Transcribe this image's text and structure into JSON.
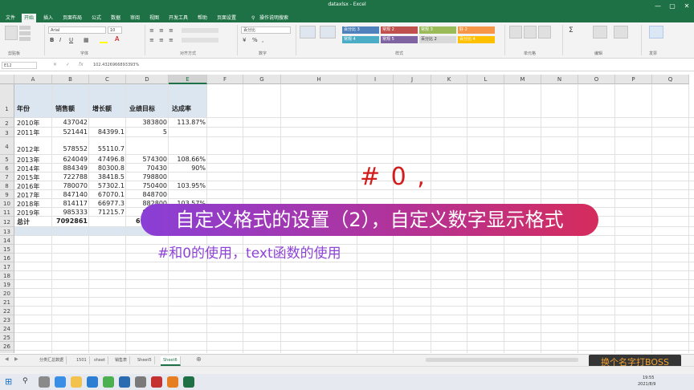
{
  "window": {
    "title": "dataxlsx - Excel",
    "controls": [
      "—",
      "▢",
      "✕"
    ]
  },
  "ribbon": {
    "tabs": [
      "文件",
      "开始",
      "插入",
      "页面布局",
      "公式",
      "数据",
      "审阅",
      "视图",
      "开发工具",
      "帮助",
      "页面设置"
    ],
    "active_tab": "开始",
    "search": "操作说明搜索",
    "font_name": "Arial",
    "font_size": "10",
    "number_format": "百分比",
    "groups": [
      "剪贴板",
      "字体",
      "对齐方式",
      "数字",
      "样式",
      "单元格",
      "编辑",
      "发票"
    ],
    "styles": [
      "百分比 3",
      "常规 2",
      "常规 3",
      "好 2",
      "常规 4",
      "常规 5",
      "百分比 2",
      "百分比 4"
    ],
    "style_colors": [
      "#4f81bd",
      "#c0504d",
      "#9bbb59",
      "#f79646",
      "#4bacc6",
      "#8064a2",
      "#d9d9d9",
      "#ffc000"
    ]
  },
  "formula_bar": {
    "name_box": "E12",
    "formula": "102.4326966893393%"
  },
  "columns": [
    "A",
    "B",
    "C",
    "D",
    "E",
    "F",
    "G",
    "H",
    "I",
    "J",
    "K",
    "L",
    "M",
    "N",
    "O",
    "P",
    "Q"
  ],
  "selected_column": "E",
  "header_row": [
    "年份",
    "销售额",
    "增长额",
    "业绩目标",
    "达成率"
  ],
  "rows": [
    {
      "n": "2",
      "a": "2010年",
      "b": "437042",
      "c": "",
      "d": "383800",
      "e": "113.87%"
    },
    {
      "n": "3",
      "a": "2011年",
      "b": "521441",
      "c": "84399.1",
      "d": "5",
      "e": ""
    },
    {
      "n": "4",
      "a": "2012年",
      "b": "578552",
      "c": "55110.7",
      "d": "",
      "e": ""
    },
    {
      "n": "5",
      "a": "2013年",
      "b": "624049",
      "c": "47496.8",
      "d": "574300",
      "e": "108.66%"
    },
    {
      "n": "6",
      "a": "2014年",
      "b": "884349",
      "c": "80300.8",
      "d": "70430",
      "e": "90%"
    },
    {
      "n": "7",
      "a": "2015年",
      "b": "722788",
      "c": "38418.5",
      "d": "798800",
      "e": ""
    },
    {
      "n": "8",
      "a": "2016年",
      "b": "780070",
      "c": "57302.1",
      "d": "750400",
      "e": "103.95%"
    },
    {
      "n": "9",
      "a": "2017年",
      "b": "847140",
      "c": "67070.1",
      "d": "848700",
      "e": ""
    },
    {
      "n": "10",
      "a": "2018年",
      "b": "814117",
      "c": "66977.3",
      "d": "882800",
      "e": "103.57%"
    },
    {
      "n": "11",
      "a": "2019年",
      "b": "985333",
      "c": "71215.7",
      "d": "913400",
      "e": ""
    }
  ],
  "total_row": {
    "n": "12",
    "a": "总计",
    "b": "7092861",
    "c": "",
    "d": "6924400",
    "e": "102.43%"
  },
  "empty_rows": [
    "13",
    "14",
    "15",
    "16",
    "17",
    "18",
    "19",
    "20",
    "21",
    "22",
    "23",
    "24",
    "25",
    "26",
    "27",
    "28"
  ],
  "overlay": {
    "format_chars": "# 0 ,",
    "banner": "自定义格式的设置（2），自定义数字显示格式",
    "subtitle": "#和0的使用，text函数的使用",
    "watermark": "换个名字打BOSS"
  },
  "sheets": [
    "分类汇总数据",
    "1501",
    "sheet",
    "销售表",
    "Sheet5",
    "Sheet6"
  ],
  "active_sheet": "Sheet6",
  "taskbar_clock": {
    "time": "19:55",
    "date": "2021/8/9"
  }
}
